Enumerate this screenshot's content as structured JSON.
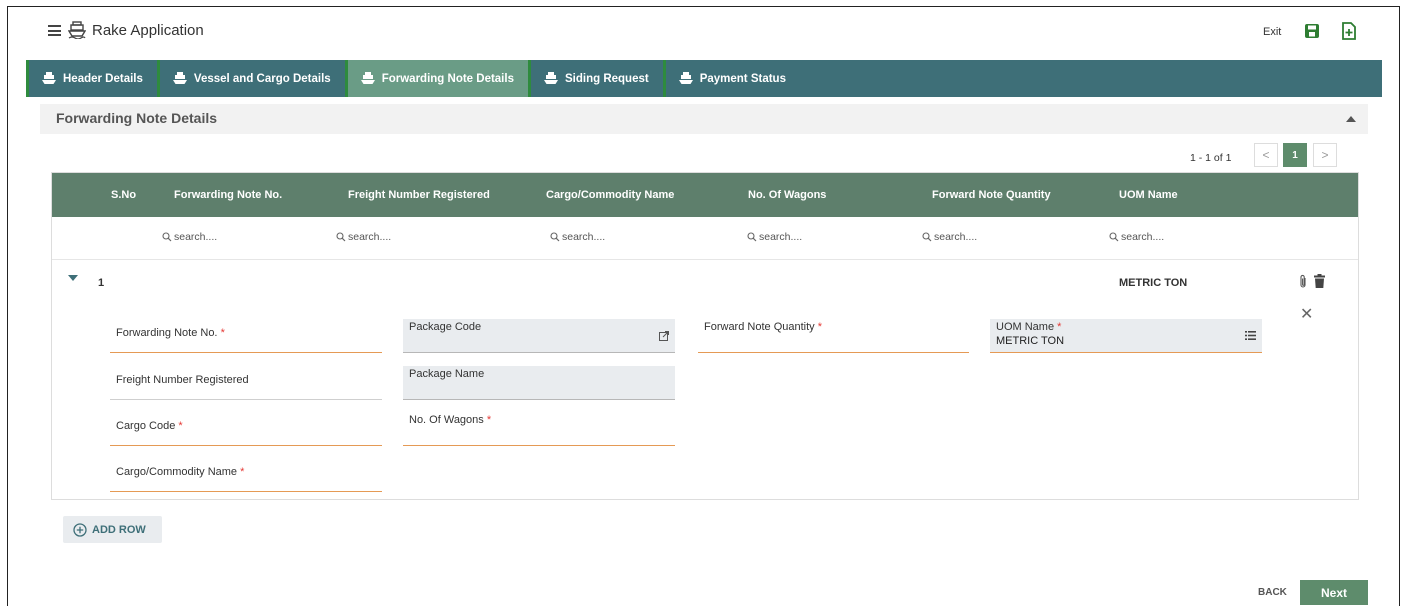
{
  "app": {
    "title": "Rake Application",
    "exit_label": "Exit"
  },
  "tabs": [
    {
      "label": "Header Details"
    },
    {
      "label": "Vessel and Cargo Details"
    },
    {
      "label": "Forwarding Note Details"
    },
    {
      "label": "Siding Request"
    },
    {
      "label": "Payment Status"
    }
  ],
  "active_tab": "Forwarding Note Details",
  "section": {
    "title": "Forwarding Note Details"
  },
  "pagination": {
    "info": "1 - 1 of 1",
    "current_page": "1",
    "prev": "<",
    "next": ">"
  },
  "grid": {
    "columns": [
      "S.No",
      "Forwarding Note No.",
      "Freight Number Registered",
      "Cargo/Commodity Name",
      "No. Of Wagons",
      "Forward Note Quantity",
      "UOM Name"
    ],
    "search_placeholder": "search....",
    "row": {
      "sno": "1",
      "uom": "METRIC TON"
    }
  },
  "form": {
    "forwarding_note_no": "Forwarding Note No.",
    "freight_number": "Freight Number Registered",
    "cargo_code": "Cargo Code",
    "cargo_commodity_name": "Cargo/Commodity Name",
    "package_code": "Package Code",
    "package_name": "Package Name",
    "no_of_wagons": "No. Of Wagons",
    "forward_note_quantity": "Forward Note Quantity",
    "uom_name": "UOM Name",
    "uom_value": "METRIC TON",
    "required_mark": "*"
  },
  "actions": {
    "add_row": "ADD ROW",
    "back": "BACK",
    "next": "Next"
  },
  "colors": {
    "tab_bar": "#3e6f78",
    "active_tab": "#6a9c86",
    "grid_header": "#5e7f6c",
    "accent_underline": "#e59a55",
    "required": "#e53935"
  }
}
